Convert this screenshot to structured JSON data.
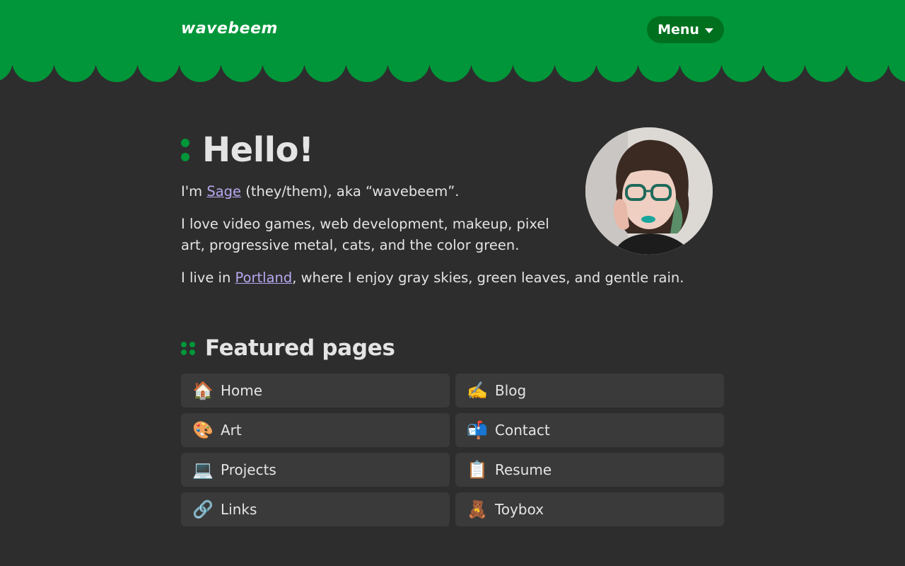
{
  "header": {
    "logo": "wavebeem",
    "menu_label": "Menu",
    "brand_color": "#009639"
  },
  "intro": {
    "heading": "Hello!",
    "p1_pre": "I'm ",
    "p1_link": "Sage",
    "p1_post": " (they/them), aka “wavebeem”.",
    "p2": "I love video games, web development, makeup, pixel art, progressive metal, cats, and the color green.",
    "p3_pre": "I live in ",
    "p3_link": "Portland",
    "p3_post": ", where I enjoy gray skies, green leaves, and gentle rain."
  },
  "featured": {
    "heading": "Featured pages",
    "items": [
      {
        "icon": "house-icon",
        "emoji": "🏠",
        "label": "Home"
      },
      {
        "icon": "writing-hand-icon",
        "emoji": "✍️",
        "label": "Blog"
      },
      {
        "icon": "palette-icon",
        "emoji": "🎨",
        "label": "Art"
      },
      {
        "icon": "mailbox-icon",
        "emoji": "📬",
        "label": "Contact"
      },
      {
        "icon": "laptop-icon",
        "emoji": "💻",
        "label": "Projects"
      },
      {
        "icon": "clipboard-icon",
        "emoji": "📋",
        "label": "Resume"
      },
      {
        "icon": "link-icon",
        "emoji": "🔗",
        "label": "Links"
      },
      {
        "icon": "teddy-bear-icon",
        "emoji": "🧸",
        "label": "Toybox"
      }
    ]
  }
}
